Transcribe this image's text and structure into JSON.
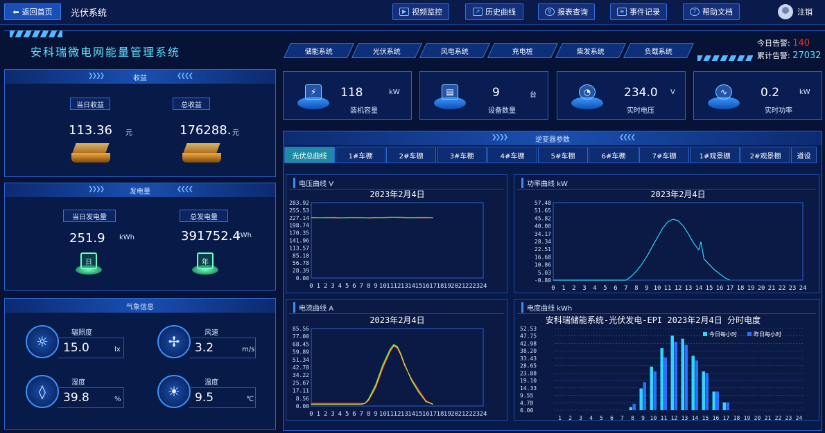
{
  "topbar": {
    "back_label": "返回首页",
    "system_title": "光伏系统",
    "nav": [
      {
        "label": "视频监控",
        "icon": "video-icon"
      },
      {
        "label": "历史曲线",
        "icon": "chart-icon"
      },
      {
        "label": "报表查询",
        "icon": "search-icon"
      },
      {
        "label": "事件记录",
        "icon": "document-icon"
      },
      {
        "label": "帮助文档",
        "icon": "help-icon"
      }
    ],
    "logout_label": "注销"
  },
  "header": {
    "title": "安科瑞微电网能量管理系统",
    "tabs": [
      "储能系统",
      "光伏系统",
      "风电系统",
      "充电桩",
      "柴发系统",
      "负载系统"
    ],
    "alarm_today_label": "今日告警:",
    "alarm_today_value": "140",
    "alarm_total_label": "累计告警:",
    "alarm_total_value": "27032"
  },
  "income": {
    "title": "收益",
    "today_label": "当日收益",
    "today_value": "113.36",
    "today_unit": "元",
    "total_label": "总收益",
    "total_value": "176288.",
    "total_unit": "元"
  },
  "generation": {
    "title": "发电量",
    "today_label": "当日发电量",
    "today_value": "251.9",
    "today_unit": "kWh",
    "today_icon": "日",
    "total_label": "总发电量",
    "total_value": "391752.4",
    "total_unit": "kWh",
    "total_icon": "年"
  },
  "weather": {
    "title": "气象信息",
    "items": [
      {
        "label": "辐照度",
        "value": "15.0",
        "unit": "lx",
        "icon": "sun-icon"
      },
      {
        "label": "风速",
        "value": "3.2",
        "unit": "m/s",
        "icon": "fan-icon"
      },
      {
        "label": "湿度",
        "value": "39.8",
        "unit": "%",
        "icon": "humidity-icon"
      },
      {
        "label": "温度",
        "value": "9.5",
        "unit": "℃",
        "icon": "thermometer-icon"
      }
    ]
  },
  "stats": [
    {
      "value": "118",
      "unit": "kW",
      "label": "装机容量",
      "icon": "panel-icon"
    },
    {
      "value": "9",
      "unit": "台",
      "label": "设备数量",
      "icon": "device-icon"
    },
    {
      "value": "234.0",
      "unit": "V",
      "label": "实时电压",
      "icon": "gauge-icon"
    },
    {
      "value": "0.2",
      "unit": "kW",
      "label": "实时功率",
      "icon": "pulse-icon"
    }
  ],
  "inverter": {
    "title": "逆变器参数",
    "tabs": [
      "光伏总曲线",
      "1#车棚",
      "2#车棚",
      "3#车棚",
      "4#车棚",
      "5#车棚",
      "6#车棚",
      "7#车棚",
      "1#观景棚",
      "2#观景棚",
      "道设"
    ]
  },
  "colors": {
    "accent": "#5fe0ff",
    "alarm": "#ff2a2a",
    "series_today": "#2fd6ff",
    "series_yesterday": "#2b6fff"
  },
  "chart_data": [
    {
      "type": "line",
      "panel": "电压曲线",
      "panel_unit": "V",
      "title": "2023年2月4日",
      "x": [
        0,
        1,
        2,
        3,
        4,
        5,
        6,
        7,
        8,
        9,
        10,
        11,
        12,
        13,
        14,
        15,
        16,
        17,
        18,
        19,
        20,
        21,
        22,
        23,
        24
      ],
      "yticks": [
        "283.92",
        "255.53",
        "227.14",
        "198.74",
        "170.35",
        "141.96",
        "113.57",
        "85.18",
        "56.78",
        "28.39",
        "0.00"
      ],
      "ylim": [
        0,
        283.92
      ],
      "series": [
        {
          "color": "#ff3030",
          "x": [
            0,
            1,
            2,
            3,
            4,
            5,
            6,
            7,
            8,
            9,
            10,
            11,
            12,
            13,
            14,
            15,
            16,
            17
          ],
          "values": [
            227,
            227,
            228,
            227,
            226,
            228,
            227,
            228,
            226,
            227,
            228,
            229,
            228,
            227,
            228,
            227,
            227,
            228
          ]
        },
        {
          "color": "#30d050",
          "x": [
            0,
            1,
            2,
            3,
            4,
            5,
            6,
            7,
            8,
            9,
            10,
            11,
            12,
            13,
            14,
            15,
            16,
            17
          ],
          "values": [
            228,
            227,
            227,
            228,
            227,
            227,
            228,
            227,
            227,
            228,
            227,
            228,
            229,
            228,
            227,
            228,
            228,
            227
          ]
        }
      ]
    },
    {
      "type": "line",
      "panel": "功率曲线",
      "panel_unit": "kW",
      "title": "2023年2月4日",
      "x": [
        0,
        1,
        2,
        3,
        4,
        5,
        6,
        7,
        8,
        9,
        10,
        11,
        12,
        13,
        14,
        15,
        16,
        17,
        18,
        19,
        20,
        21,
        22,
        23,
        24
      ],
      "yticks": [
        "57.48",
        "51.65",
        "45.82",
        "40.00",
        "34.17",
        "28.34",
        "22.51",
        "16.68",
        "10.86",
        "5.03",
        "-0.80"
      ],
      "ylim": [
        -0.8,
        57.48
      ],
      "series": [
        {
          "color": "#2fd6ff",
          "x": [
            0,
            7,
            7.5,
            8,
            8.5,
            9,
            9.5,
            10,
            10.5,
            11,
            11.5,
            12,
            12.5,
            13,
            13.5,
            14,
            14.2,
            14.5,
            15,
            15.5,
            16,
            16.5,
            17
          ],
          "values": [
            -0.8,
            -0.8,
            2,
            6,
            11,
            17,
            24,
            31,
            38,
            43,
            45,
            44,
            40,
            34,
            27,
            22,
            28,
            15,
            11,
            7,
            4,
            1,
            -0.8
          ]
        }
      ]
    },
    {
      "type": "line",
      "panel": "电流曲线",
      "panel_unit": "A",
      "title": "2023年2月4日",
      "x": [
        0,
        1,
        2,
        3,
        4,
        5,
        6,
        7,
        8,
        9,
        10,
        11,
        12,
        13,
        14,
        15,
        16,
        17,
        18,
        19,
        20,
        21,
        22,
        23,
        24
      ],
      "yticks": [
        "85.56",
        "77.00",
        "68.45",
        "59.89",
        "51.34",
        "42.78",
        "34.22",
        "25.67",
        "17.11",
        "8.56",
        "0.00"
      ],
      "ylim": [
        0,
        85.56
      ],
      "series": [
        {
          "color": "#ff3030",
          "x": [
            0,
            7,
            7.5,
            8,
            9,
            10,
            11,
            11.5,
            12,
            12.5,
            13,
            14,
            15,
            16,
            17
          ],
          "values": [
            3,
            3,
            3,
            6,
            20,
            42,
            60,
            66,
            64,
            56,
            45,
            30,
            18,
            6,
            2
          ]
        },
        {
          "color": "#30d050",
          "x": [
            0,
            7,
            7.5,
            8,
            9,
            10,
            11,
            11.5,
            12,
            12.5,
            13,
            14,
            15,
            16,
            17
          ],
          "values": [
            2,
            2,
            3,
            8,
            24,
            46,
            63,
            68,
            66,
            58,
            47,
            28,
            15,
            5,
            2
          ]
        },
        {
          "color": "#e0d040",
          "x": [
            0,
            7,
            7.5,
            8,
            9,
            10,
            11,
            11.5,
            12,
            12.5,
            13,
            14,
            15,
            16,
            17
          ],
          "values": [
            2,
            2,
            3,
            7,
            22,
            44,
            61,
            67,
            65,
            57,
            46,
            29,
            16,
            5,
            2
          ]
        }
      ]
    },
    {
      "type": "bar",
      "panel": "电度曲线",
      "panel_unit": "kWh",
      "title": "安科瑞储能系统-光伏发电-EPI 2023年2月4日 分时电度",
      "categories": [
        "1",
        "2",
        "3",
        "4",
        "5",
        "6",
        "7",
        "8",
        "9",
        "10",
        "11",
        "12",
        "13",
        "14",
        "15",
        "16",
        "17",
        "18",
        "19",
        "20",
        "21",
        "22",
        "23",
        "24"
      ],
      "yticks": [
        "52.53",
        "47.75",
        "42.98",
        "38.20",
        "33.43",
        "28.65",
        "23.88",
        "19.10",
        "14.33",
        "9.55",
        "4.78",
        "0.00"
      ],
      "ylim": [
        0,
        52.53
      ],
      "series": [
        {
          "name": "今日每小时",
          "color": "#2fd6ff",
          "values": [
            0,
            0,
            0,
            0,
            0,
            0,
            0,
            2,
            14,
            28,
            40,
            48,
            46,
            35,
            25,
            12,
            5,
            0,
            0,
            0,
            0,
            0,
            0,
            0
          ]
        },
        {
          "name": "昨日每小时",
          "color": "#2b6fff",
          "values": [
            0,
            0,
            0,
            0,
            0,
            0,
            0,
            4,
            18,
            25,
            34,
            44,
            42,
            32,
            24,
            12,
            5,
            0,
            0,
            0,
            0,
            0,
            0,
            0
          ]
        }
      ]
    }
  ]
}
